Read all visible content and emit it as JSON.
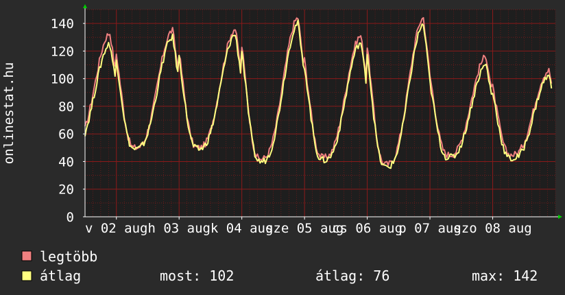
{
  "chart_data": {
    "type": "line",
    "ylabel": "onlinestat.hu",
    "ylim": [
      0,
      150
    ],
    "yticks": [
      0,
      20,
      40,
      60,
      80,
      100,
      120,
      140
    ],
    "xticks": [
      "v 02 aug",
      "h 03 aug",
      "k 04 aug",
      "sze 05 aug",
      "cs 06 aug",
      "p 07 aug",
      "szo 08 aug"
    ],
    "grid": true,
    "colors": {
      "background": "#2a2a2a",
      "plot_background": "#1e1e1e",
      "grid": "#8b1a1a",
      "axis": "#ffffff",
      "legtobb": "#f08080",
      "atlag": "#ffff80",
      "axis_arrow": "#00cc00"
    },
    "series": [
      {
        "name": "legtöbb",
        "color": "#f08080",
        "daily": [
          {
            "min": 52,
            "max": 133
          },
          {
            "min": 50,
            "max": 135
          },
          {
            "min": 50,
            "max": 136
          },
          {
            "min": 42,
            "max": 144
          },
          {
            "min": 43,
            "max": 131
          },
          {
            "min": 38,
            "max": 144
          },
          {
            "min": 45,
            "max": 116
          },
          {
            "min": 45,
            "max": 106
          }
        ]
      },
      {
        "name": "átlag",
        "color": "#ffff80",
        "daily": [
          {
            "min": 50,
            "max": 125
          },
          {
            "min": 49,
            "max": 130
          },
          {
            "min": 49,
            "max": 132
          },
          {
            "min": 40,
            "max": 140
          },
          {
            "min": 41,
            "max": 126
          },
          {
            "min": 36,
            "max": 139
          },
          {
            "min": 43,
            "max": 110
          },
          {
            "min": 42,
            "max": 102
          }
        ]
      }
    ]
  },
  "legend": {
    "items": [
      {
        "label": "legtöbb",
        "color": "#f08080"
      },
      {
        "label": "átlag",
        "color": "#ffff80"
      }
    ],
    "stats": {
      "most": "most: 102",
      "atlag": "átlag: 76",
      "max": "max: 142"
    }
  }
}
